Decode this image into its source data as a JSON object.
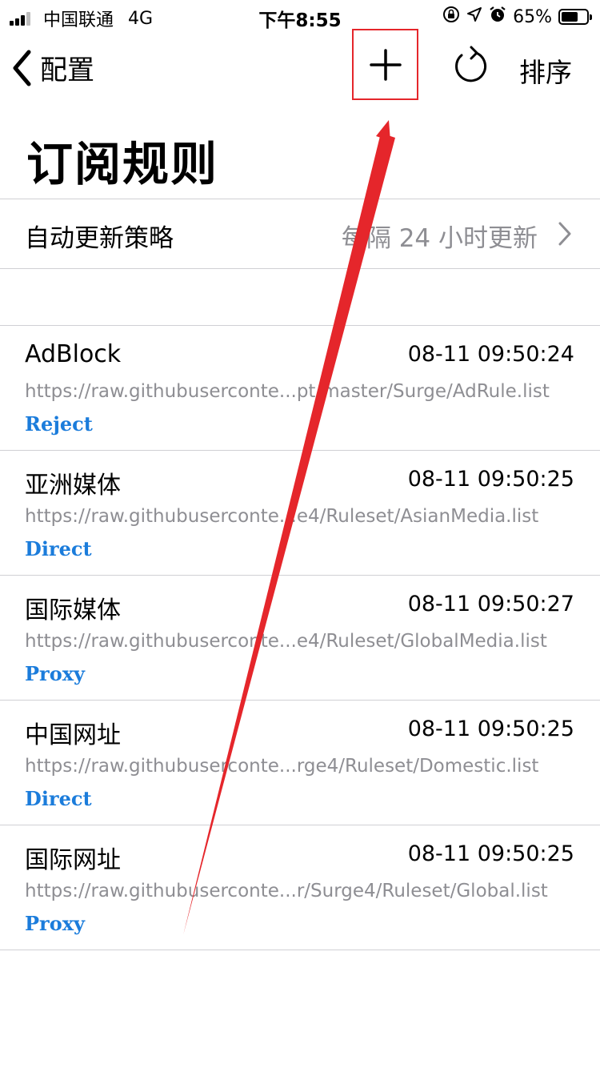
{
  "status_bar": {
    "carrier": "中国联通",
    "network": "4G",
    "time": "下午8:55",
    "battery_percent": "65%",
    "battery_level": 0.65,
    "icons": [
      "orientation-lock-icon",
      "location-icon",
      "alarm-icon"
    ]
  },
  "nav": {
    "back_label": "配置",
    "add_icon": "plus-icon",
    "refresh_icon": "refresh-icon",
    "sort_label": "排序",
    "highlight_color": "#e5262b"
  },
  "page": {
    "title": "订阅规则"
  },
  "auto_update": {
    "label": "自动更新策略",
    "value": "每隔 24 小时更新"
  },
  "rules": [
    {
      "name": "AdBlock",
      "time": "08-11 09:50:24",
      "url": "https://raw.githubuserconte...pt/master/Surge/AdRule.list",
      "policy": "Reject"
    },
    {
      "name": "亚洲媒体",
      "time": "08-11 09:50:25",
      "url": "https://raw.githubuserconte...e4/Ruleset/AsianMedia.list",
      "policy": "Direct"
    },
    {
      "name": "国际媒体",
      "time": "08-11 09:50:27",
      "url": "https://raw.githubuserconte...e4/Ruleset/GlobalMedia.list",
      "policy": "Proxy"
    },
    {
      "name": "中国网址",
      "time": "08-11 09:50:25",
      "url": "https://raw.githubuserconte...rge4/Ruleset/Domestic.list",
      "policy": "Direct"
    },
    {
      "name": "国际网址",
      "time": "08-11 09:50:25",
      "url": "https://raw.githubuserconte...r/Surge4/Ruleset/Global.list",
      "policy": "Proxy"
    }
  ],
  "colors": {
    "policy": "#1b7cdb",
    "secondary_text": "#8e8e93",
    "annotation": "#e5262b"
  }
}
